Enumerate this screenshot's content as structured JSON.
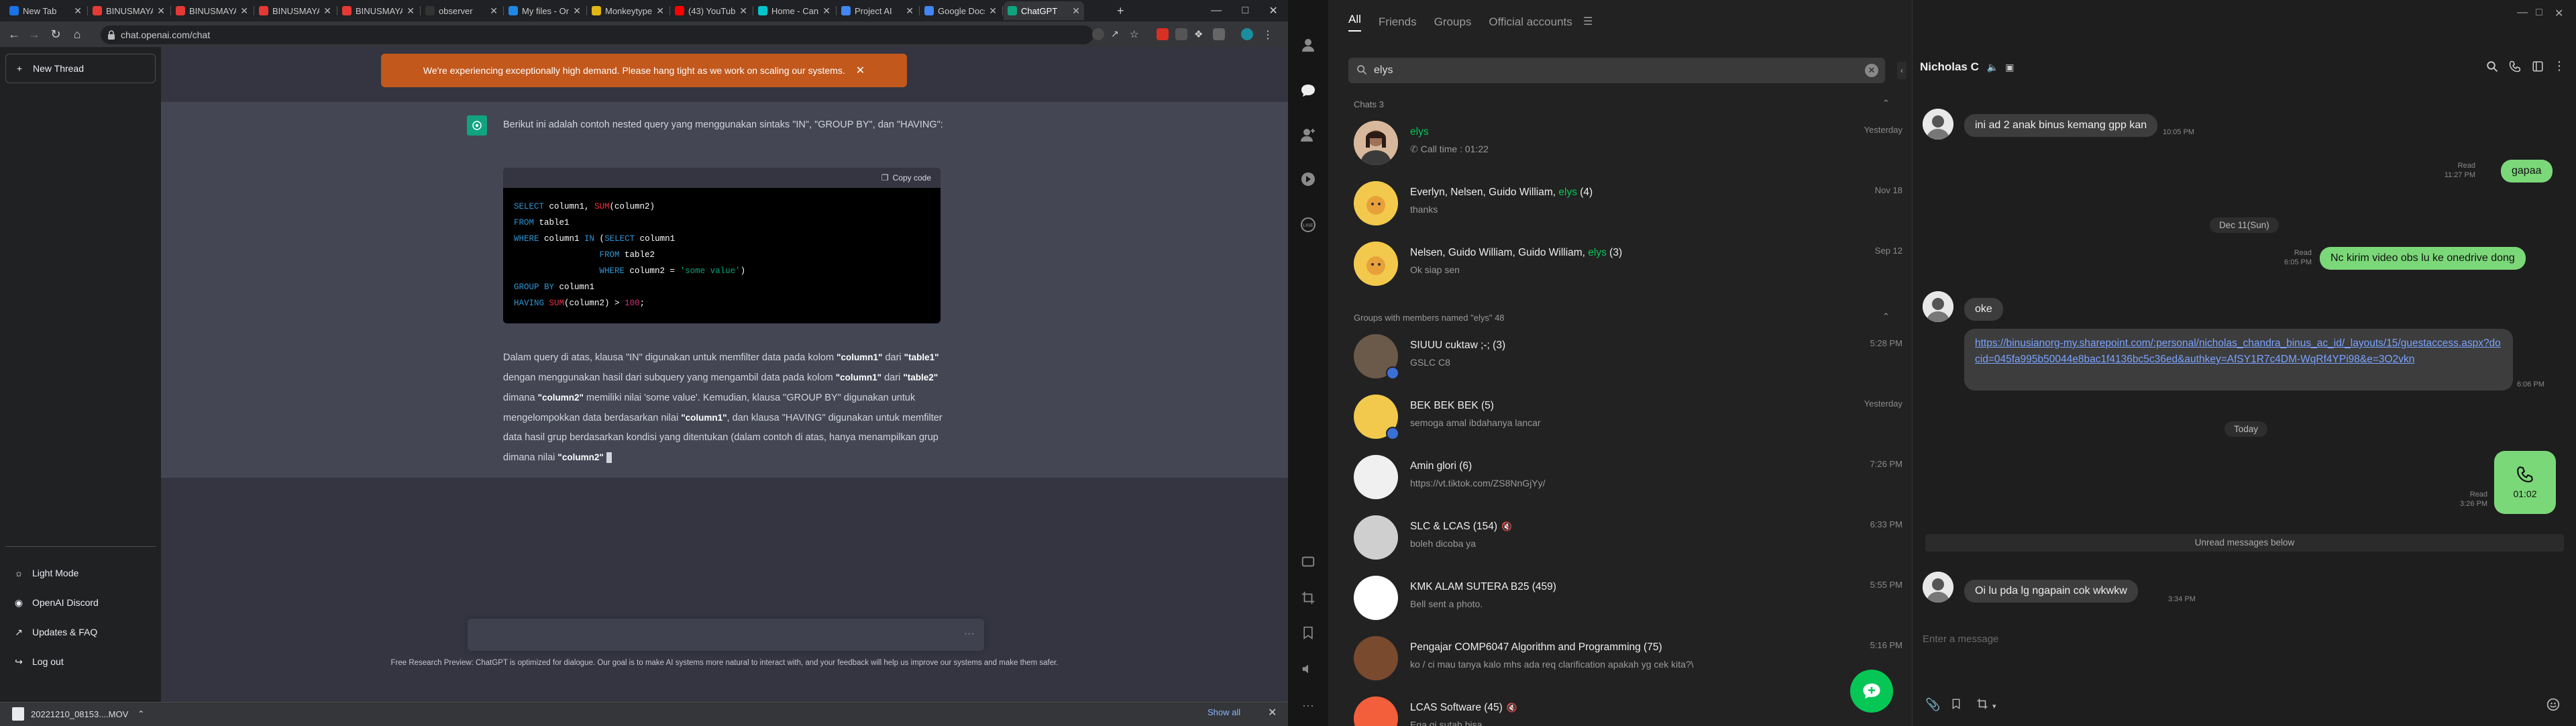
{
  "browser": {
    "tabs": [
      {
        "label": "New Tab",
        "color": "#1a73e8"
      },
      {
        "label": "BINUSMAYA",
        "color": "#e53935"
      },
      {
        "label": "BINUSMAYA",
        "color": "#e53935"
      },
      {
        "label": "BINUSMAYA",
        "color": "#e53935"
      },
      {
        "label": "BINUSMAYA",
        "color": "#e53935"
      },
      {
        "label": "observer",
        "color": "#333333"
      },
      {
        "label": "My files - OneDrive",
        "color": "#1e88e5"
      },
      {
        "label": "Monkeytype",
        "color": "#e2b714"
      },
      {
        "label": "(43) YouTube",
        "color": "#ff0000"
      },
      {
        "label": "Home - Canva",
        "color": "#00c4cc"
      },
      {
        "label": "Project AI",
        "color": "#4285f4"
      },
      {
        "label": "Google Docs",
        "color": "#4285f4"
      },
      {
        "label": "ChatGPT",
        "color": "#10a37f"
      }
    ],
    "new_tab_symbol": "+",
    "url": "chat.openai.com/chat"
  },
  "chatgpt": {
    "sidebar": {
      "new_thread": "New Thread",
      "light_mode": "Light Mode",
      "discord": "OpenAI Discord",
      "updates": "Updates & FAQ",
      "logout": "Log out"
    },
    "banner": "We're experiencing exceptionally high demand. Please hang tight as we work on scaling our systems.",
    "intro": "Berikut ini adalah contoh nested query yang menggunakan sintaks \"IN\", \"GROUP BY\", dan \"HAVING\":",
    "copy_code": "Copy code",
    "explanation": {
      "p1": "Dalam query di atas, klausa \"IN\" digunakan untuk memfilter data pada kolom ",
      "c1": "\"column1\"",
      "p2": " dari ",
      "c2": "\"table1\"",
      "p3": " dengan menggunakan hasil dari subquery yang mengambil data pada kolom ",
      "c3": "\"column1\"",
      "p4": " dari ",
      "c4": "\"table2\"",
      "p5": " dimana ",
      "c5": "\"column2\"",
      "p6": " memiliki nilai 'some value'. Kemudian, klausa \"GROUP BY\" digunakan untuk mengelompokkan data berdasarkan nilai ",
      "c6": "\"column1\"",
      "p7": ", dan klausa \"HAVING\" digunakan untuk memfilter data hasil grup berdasarkan kondisi yang ditentukan (dalam contoh di atas, hanya menampilkan grup dimana nilai ",
      "c7": "\"column2\""
    },
    "footnote": "Free Research Preview: ChatGPT is optimized for dialogue. Our goal is to make AI systems more natural to interact with, and your feedback will help us improve our systems and make them safer."
  },
  "downloads": {
    "file": "20221210_08153....MOV",
    "show_all": "Show all"
  },
  "line": {
    "filter_tabs": [
      "All",
      "Friends",
      "Groups",
      "Official accounts"
    ],
    "search_value": "elys",
    "chats_header": "Chats 3",
    "groups_header": "Groups with members named \"elys\" 48",
    "chats": [
      {
        "name": "elys",
        "sub": "Call time : 01:22",
        "time": "Yesterday"
      },
      {
        "name_pre": "Everlyn, Nelsen, Guido William, ",
        "name_hl": "elys",
        "name_post": " (4)",
        "sub": "thanks",
        "time": "Nov 18"
      },
      {
        "name_pre": "Nelsen, Guido William, Guido William, ",
        "name_hl": "elys",
        "name_post": " (3)",
        "sub": "Ok siap sen",
        "time": "Sep 12"
      }
    ],
    "groups": [
      {
        "name": "SIUUU cuktaw ;-; (3)",
        "sub": "GSLC C8",
        "time": "5:28 PM",
        "color": "#6b5a4a"
      },
      {
        "name": "BEK BEK BEK (5)",
        "sub": "semoga amal ibdahanya lancar",
        "time": "Yesterday",
        "color": "#f2c94c"
      },
      {
        "name": "Amin glori (6)",
        "sub": "https://vt.tiktok.com/ZS8NnGjYy/",
        "time": "7:26 PM",
        "color": "#f0f0f0"
      },
      {
        "name": "SLC & LCAS (154)",
        "sub": "boleh dicoba ya",
        "time": "6:33 PM",
        "color": "#cfcfcf"
      },
      {
        "name": "KMK ALAM SUTERA B25 (459)",
        "sub": "Bell sent a photo.",
        "time": "5:55 PM",
        "color": "#ffffff"
      },
      {
        "name": "Pengajar COMP6047 Algorithm and Programming (75)",
        "sub": "ko / ci mau tanya kalo mhs ada req clarification apakah yg cek kita?\\",
        "time": "5:16 PM",
        "color": "#7a4a2e"
      },
      {
        "name": "LCAS Software (45)",
        "sub": "Ega gi sutab bisa",
        "time": "",
        "color": "#f25f3a"
      }
    ],
    "chat": {
      "title": "Nicholas C",
      "messages": {
        "m1": "ini ad 2 anak binus kemang gpp kan",
        "m1_time": "10:05 PM",
        "m2": "gapaa",
        "m2_meta": "Read",
        "m2_time": "11:27 PM",
        "date1": "Dec 11(Sun)",
        "m3": "Nc kirim video obs lu ke onedrive dong",
        "m3_meta": "Read",
        "m3_time": "6:05 PM",
        "m4": "oke",
        "m5": "https://binusianorg-my.sharepoint.com/:personal/nicholas_chandra_binus_ac_id/_layouts/15/guestaccess.aspx?docid=045fa995b50044e8bac1f4136bc5c36ed&authkey=AfSY1R7c4DM-WqRf4YPi98&e=3O2vkn",
        "m5_time": "6:06 PM",
        "date2": "Today",
        "call_duration": "01:02",
        "call_meta": "Read",
        "call_time": "3:26 PM",
        "unread": "Unread messages below",
        "m6": "Oi lu pda lg ngapain cok wkwkw",
        "m6_time": "3:34 PM"
      },
      "input_placeholder": "Enter a message"
    }
  }
}
